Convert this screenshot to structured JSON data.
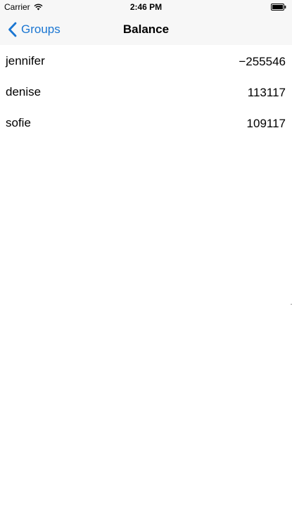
{
  "status_bar": {
    "carrier": "Carrier",
    "time": "2:46 PM",
    "wifi_icon": "wifi-icon",
    "battery_icon": "battery-full-icon"
  },
  "nav": {
    "back_label": "Groups",
    "back_icon": "chevron-left-icon",
    "title": "Balance",
    "accent_color": "#1a76d2"
  },
  "balances": [
    {
      "name": "jennifer",
      "value": "−255546"
    },
    {
      "name": "denise",
      "value": "113117"
    },
    {
      "name": "sofie",
      "value": "109117"
    }
  ]
}
